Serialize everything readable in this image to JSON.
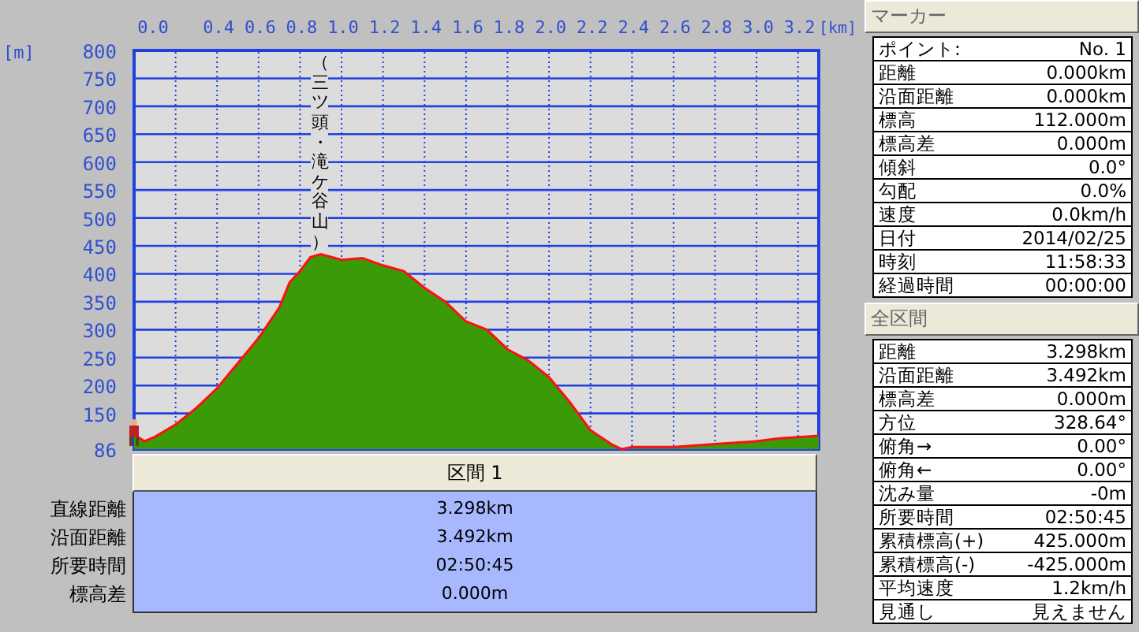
{
  "chart": {
    "chart_data": {
      "type": "area",
      "xlabel": "[km]",
      "ylabel": "[m]",
      "xlim": [
        0,
        3.3
      ],
      "ylim": [
        86,
        800
      ],
      "grid": true,
      "xticks": [
        {
          "value": 0,
          "label": "0.0"
        },
        {
          "value": 0.4,
          "label": "0.4"
        },
        {
          "value": 0.6,
          "label": "0.6"
        },
        {
          "value": 0.8,
          "label": "0.8"
        },
        {
          "value": 1,
          "label": "1.0"
        },
        {
          "value": 1.2,
          "label": "1.2"
        },
        {
          "value": 1.4,
          "label": "1.4"
        },
        {
          "value": 1.6,
          "label": "1.6"
        },
        {
          "value": 1.8,
          "label": "1.8"
        },
        {
          "value": 2,
          "label": "2.0"
        },
        {
          "value": 2.2,
          "label": "2.2"
        },
        {
          "value": 2.4,
          "label": "2.4"
        },
        {
          "value": 2.6,
          "label": "2.6"
        },
        {
          "value": 2.8,
          "label": "2.8"
        },
        {
          "value": 3,
          "label": "3.0"
        },
        {
          "value": 3.2,
          "label": "3.2"
        }
      ],
      "yticks": [
        86,
        150,
        200,
        250,
        300,
        350,
        400,
        450,
        500,
        550,
        600,
        650,
        700,
        750,
        800
      ],
      "x": [
        0,
        0.05,
        0.1,
        0.2,
        0.3,
        0.4,
        0.5,
        0.6,
        0.7,
        0.75,
        0.8,
        0.85,
        0.9,
        1.0,
        1.1,
        1.2,
        1.3,
        1.4,
        1.5,
        1.6,
        1.7,
        1.8,
        1.9,
        2.0,
        2.1,
        2.2,
        2.3,
        2.35,
        2.4,
        2.6,
        2.8,
        3.0,
        3.1,
        3.3
      ],
      "series": [
        {
          "color": "#3a9a08",
          "values": [
            112,
            100,
            108,
            130,
            160,
            195,
            240,
            285,
            340,
            385,
            405,
            430,
            435,
            425,
            428,
            415,
            405,
            375,
            350,
            315,
            300,
            265,
            245,
            215,
            170,
            120,
            95,
            86,
            90,
            90,
            95,
            100,
            105,
            110
          ]
        }
      ],
      "annotations": [
        "（三ツ頭・滝ケ谷山）"
      ]
    }
  },
  "section": {
    "header": "区間 1",
    "rows": [
      {
        "label": "直線距離",
        "value": "3.298km"
      },
      {
        "label": "沿面距離",
        "value": "3.492km"
      },
      {
        "label": "所要時間",
        "value": "02:50:45"
      },
      {
        "label": "標高差",
        "value": "0.000m"
      }
    ]
  },
  "marker": {
    "title": "マーカー",
    "rows": [
      {
        "label": "ポイント:",
        "value": "No. 1"
      },
      {
        "label": "距離",
        "value": "0.000km"
      },
      {
        "label": "沿面距離",
        "value": "0.000km"
      },
      {
        "label": "標高",
        "value": "112.000m"
      },
      {
        "label": "標高差",
        "value": "0.000m"
      },
      {
        "label": "傾斜",
        "value": "0.0°"
      },
      {
        "label": "勾配",
        "value": "0.0%"
      },
      {
        "label": "速度",
        "value": "0.0km/h"
      },
      {
        "label": "日付",
        "value": "2014/02/25"
      },
      {
        "label": "時刻",
        "value": "11:58:33"
      },
      {
        "label": "経過時間",
        "value": "00:00:00"
      }
    ]
  },
  "total": {
    "title": "全区間",
    "rows": [
      {
        "label": "距離",
        "value": "3.298km"
      },
      {
        "label": "沿面距離",
        "value": "3.492km"
      },
      {
        "label": "標高差",
        "value": "0.000m"
      },
      {
        "label": "方位",
        "value": "328.64°"
      },
      {
        "label": "俯角→",
        "value": "0.00°"
      },
      {
        "label": "俯角←",
        "value": "0.00°"
      },
      {
        "label": "沈み量",
        "value": "-0m"
      },
      {
        "label": "所要時間",
        "value": "02:50:45"
      },
      {
        "label": "累積標高(+)",
        "value": "425.000m"
      },
      {
        "label": "累積標高(-)",
        "value": "-425.000m"
      },
      {
        "label": "平均速度",
        "value": "1.2km/h"
      },
      {
        "label": "見通し",
        "value": "見えません"
      }
    ]
  }
}
